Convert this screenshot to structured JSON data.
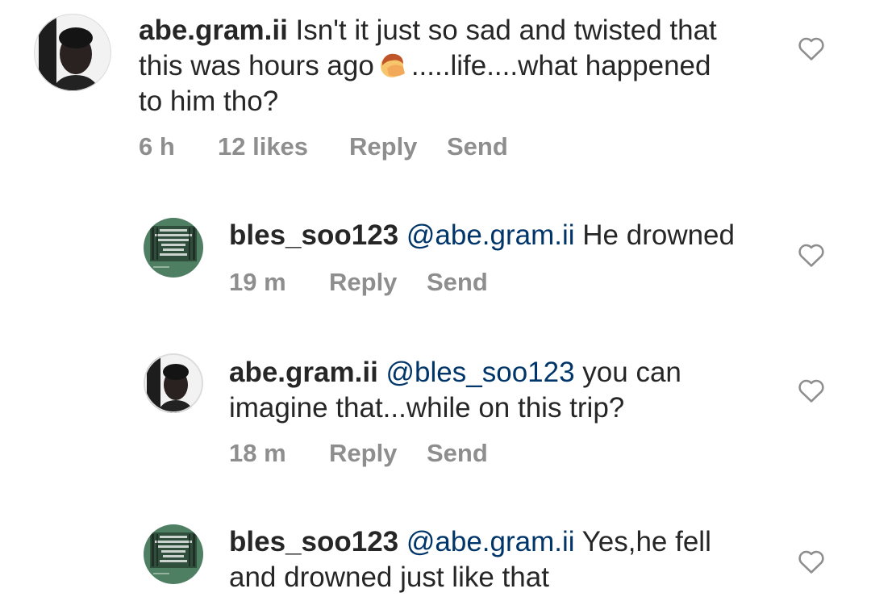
{
  "comments": [
    {
      "username": "abe.gram.ii",
      "text_line1": "Isn't it just so sad and twisted that",
      "text_line2_before": "this was hours ago",
      "emoji": "face-palm-emoji",
      "text_line2_after": ".....life....what happened",
      "text_line3": "to him tho?",
      "time": "6 h",
      "likes": "12 likes",
      "reply": "Reply",
      "send": "Send"
    },
    {
      "username": "bles_soo123",
      "mention": "@abe.gram.ii",
      "text": "He drowned",
      "time": "19 m",
      "reply": "Reply",
      "send": "Send"
    },
    {
      "username": "abe.gram.ii",
      "mention": "@bles_soo123",
      "text_line1": "you can",
      "text_line2": "imagine that...while on this trip?",
      "time": "18 m",
      "reply": "Reply",
      "send": "Send"
    },
    {
      "username": "bles_soo123",
      "mention": "@abe.gram.ii",
      "text_line1": "Yes,he fell",
      "text_line2": "and drowned just like that"
    }
  ],
  "icons": {
    "like": "heart-outline-icon",
    "avatar_person": "person-avatar",
    "avatar_poster": "green-poster-avatar"
  },
  "colors": {
    "text": "#262626",
    "mention": "#003569",
    "meta": "#8e8e8e",
    "heart": "#8e8e8e",
    "poster_green": "#4f7f63"
  }
}
